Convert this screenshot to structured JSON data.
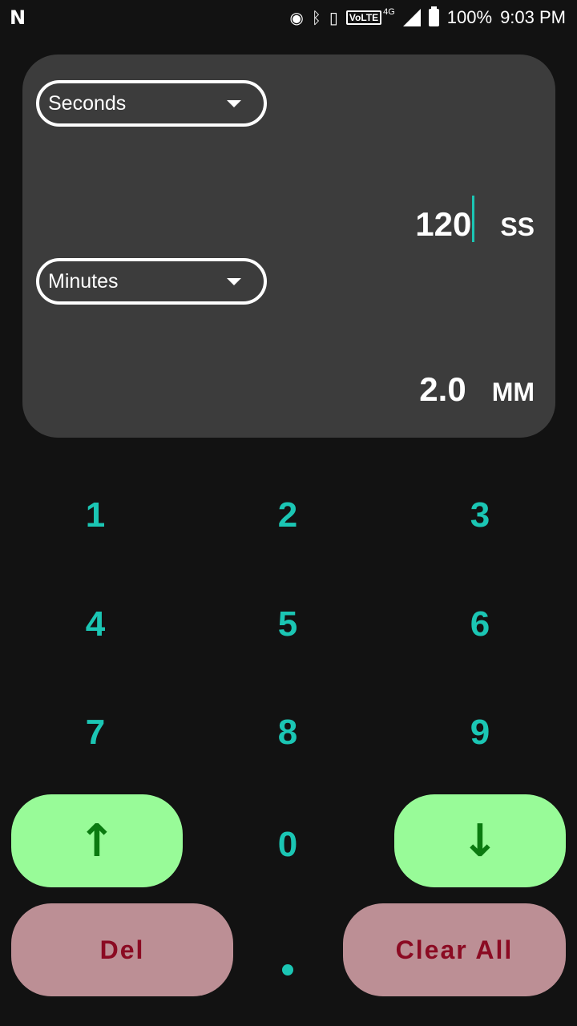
{
  "status_bar": {
    "left_icon": "n-notification-icon",
    "icons": [
      "hotspot-icon",
      "bluetooth-icon",
      "vibrate-icon"
    ],
    "volte": "VoLTE",
    "network": "4G",
    "battery": "100%",
    "time": "9:03 PM"
  },
  "converter": {
    "from_unit": "Seconds",
    "from_value": "120",
    "from_abbr": "SS",
    "to_unit": "Minutes",
    "to_value": "2.0",
    "to_abbr": "MM"
  },
  "keypad": {
    "k1": "1",
    "k2": "2",
    "k3": "3",
    "k4": "4",
    "k5": "5",
    "k6": "6",
    "k7": "7",
    "k8": "8",
    "k9": "9",
    "k0": "0"
  },
  "buttons": {
    "up": "↑",
    "down": "↓",
    "del": "Del",
    "clear_all": "Clear All"
  },
  "colors": {
    "background": "#121212",
    "panel": "#3c3c3c",
    "accent": "#1bc6b4",
    "arrow_button": "#98fb98",
    "action_button": "#bc8f95",
    "action_text": "#8b0a22"
  }
}
